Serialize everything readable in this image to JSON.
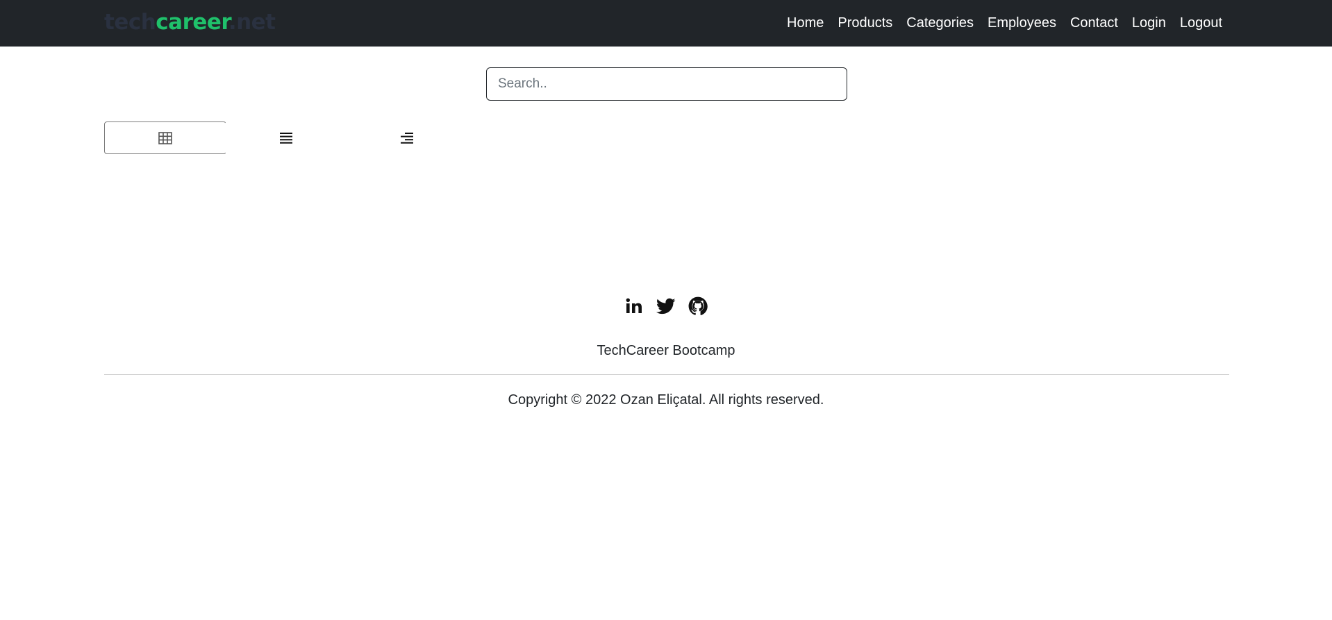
{
  "navbar": {
    "brand": {
      "part1": "tech",
      "part2": "career",
      "part3": ".net"
    },
    "links": [
      "Home",
      "Products",
      "Categories",
      "Employees",
      "Contact",
      "Login",
      "Logout"
    ]
  },
  "search": {
    "placeholder": "Search..",
    "value": ""
  },
  "view_toggles": [
    {
      "icon": "table-icon",
      "active": true
    },
    {
      "icon": "list-icon",
      "active": false
    },
    {
      "icon": "align-right-icon",
      "active": false
    }
  ],
  "footer": {
    "social": [
      "linkedin-icon",
      "twitter-icon",
      "github-icon"
    ],
    "title": "TechCareer Bootcamp",
    "copyright": "Copyright © 2022 Ozan Eliçatal. All rights reserved."
  },
  "colors": {
    "navbar_bg": "#212529",
    "brand_green": "#1fc16b",
    "brand_dark": "#2a3140"
  }
}
